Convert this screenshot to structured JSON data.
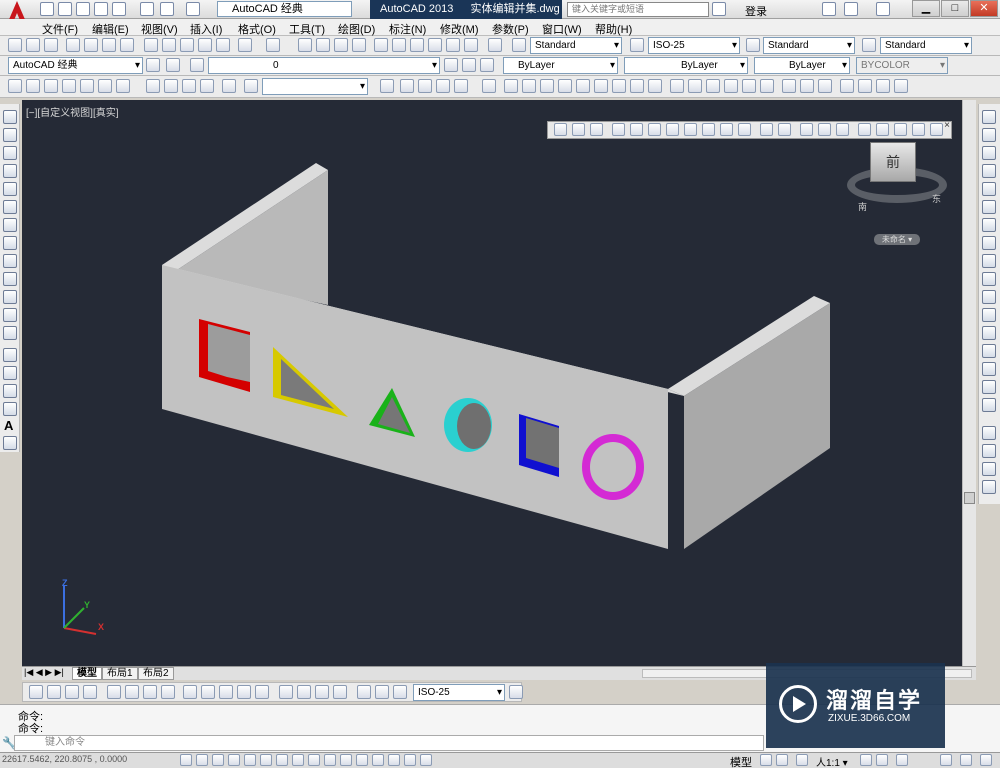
{
  "title_bar": {
    "workspace": "AutoCAD 经典",
    "app_name": "AutoCAD 2013",
    "document": "实体编辑并集.dwg",
    "search_placeholder": "键入关键字或短语",
    "login": "登录",
    "minimize_glyph": "▁",
    "maximize_glyph": "□",
    "close_glyph": "✕"
  },
  "menu": [
    "文件(F)",
    "编辑(E)",
    "视图(V)",
    "插入(I)",
    "格式(O)",
    "工具(T)",
    "绘图(D)",
    "标注(N)",
    "修改(M)",
    "参数(P)",
    "窗口(W)",
    "帮助(H)"
  ],
  "styles_toolbar": {
    "text_style": "Standard",
    "dim_style": "ISO-25",
    "table_style": "Standard",
    "mleader_style": "Standard"
  },
  "layers_toolbar": {
    "workspace": "AutoCAD 经典",
    "layer": "0",
    "color": "ByLayer",
    "linetype": "ByLayer",
    "lineweight": "ByLayer",
    "plotstyle": "BYCOLOR"
  },
  "viewport": {
    "label": "[−][自定义视图][真实]",
    "viewcube_face": "前",
    "viewcube_south": "南",
    "viewcube_east": "东",
    "wcs": "未命名 ▾",
    "ucs_x": "X",
    "ucs_y": "Y",
    "ucs_z": "Z"
  },
  "layout_tabs": [
    "模型",
    "布局1",
    "布局2"
  ],
  "dim_toolbar": {
    "dim_style": "ISO-25"
  },
  "command": {
    "history": [
      "命令:",
      "命令:"
    ],
    "placeholder": "键入命令"
  },
  "status": {
    "coords": "22617.5462, 220.8075 , 0.0000",
    "model": "模型",
    "annotation_scale": "人1:1 ▾"
  },
  "watermark": {
    "name": "溜溜自学",
    "url": "ZIXUE.3D66.COM"
  },
  "colors": {
    "viewport_bg": "#252a36",
    "solid": "#c2c2c2",
    "red": "#d40000",
    "yellow": "#d7c900",
    "green": "#19b219",
    "cyan": "#2ad0d0",
    "blue": "#1010d0",
    "magenta": "#d42ad4"
  }
}
